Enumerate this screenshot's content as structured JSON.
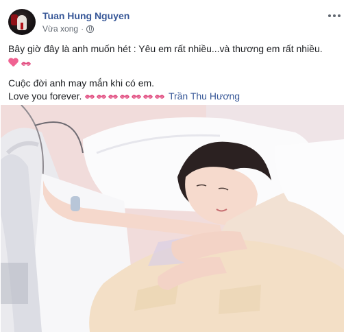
{
  "post": {
    "author": "Tuan Hung Nguyen",
    "time": "Vừa xong",
    "separator": "·",
    "privacy_icon": "globe-icon",
    "more_icon": "more-options-icon",
    "line1": "Bây giờ đây là anh muốn hét : Yêu em rất nhiều...và thương em rất nhiều.",
    "line2_emojis": [
      "heart-emoji",
      "kiss-emoji"
    ],
    "line3": "Cuộc đời anh may mắn khi có em.",
    "line4": "Love you forever.",
    "line4_emojis": [
      "kiss-emoji",
      "kiss-emoji",
      "kiss-emoji",
      "kiss-emoji",
      "kiss-emoji",
      "kiss-emoji",
      "kiss-emoji"
    ],
    "mention": "Trần Thu Hương"
  },
  "colors": {
    "link": "#385898",
    "meta": "#606770",
    "text": "#1c1e21",
    "heart": "#f06292",
    "kiss": "#e0457b"
  }
}
